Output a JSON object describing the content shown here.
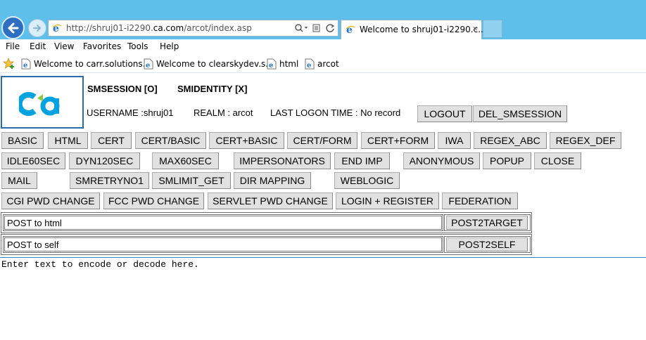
{
  "browser": {
    "address_url_prefix": "http://shruj01-i2290.",
    "address_url_domain": "ca.com",
    "address_url_suffix": "/arcot/index.asp",
    "tab_title": "Welcome to shruj01-i2290.c...",
    "tab_close": "×",
    "address_icons": {
      "search": "search-icon",
      "compat": "compatibility-view-icon",
      "refresh": "refresh-icon"
    },
    "accent_color": "#5ec0ea"
  },
  "menubar": {
    "items": [
      "File",
      "Edit",
      "View",
      "Favorites",
      "Tools",
      "Help"
    ]
  },
  "favorites": {
    "items": [
      "Welcome to carr.solutions....",
      "Welcome to clearskydev.s...",
      "html",
      "arcot"
    ]
  },
  "header": {
    "smsession": "SMSESSION [O]",
    "smidentity": "SMIDENTITY [X]",
    "username": "USERNAME :shruj01",
    "realm": "REALM : arcot",
    "last_logon": "LAST LOGON TIME : No record",
    "logout_label": "LOGOUT",
    "del_smsession_label": "DEL_SMSESSION"
  },
  "buttons": {
    "row1": [
      "BASIC",
      "HTML",
      "CERT",
      "CERT/BASIC",
      "CERT+BASIC",
      "CERT/FORM",
      "CERT+FORM",
      "IWA",
      "REGEX_ABC",
      "REGEX_DEF"
    ],
    "row2": [
      "IDLE60SEC",
      "DYN120SEC",
      "MAX60SEC",
      "IMPERSONATORS",
      "END IMP",
      "ANONYMOUS",
      "POPUP",
      "CLOSE"
    ],
    "row3": [
      "MAIL",
      "SMRETRYNO1",
      "SMLIMIT_GET",
      "DIR MAPPING",
      "WEBLOGIC"
    ],
    "row4": [
      "CGI PWD CHANGE",
      "FCC PWD CHANGE",
      "SERVLET PWD CHANGE",
      "LOGIN + REGISTER",
      "FEDERATION"
    ]
  },
  "post_forms": {
    "html_field_value": "POST to html",
    "html_button": "POST2TARGET",
    "self_field_value": "POST to self",
    "self_button": "POST2SELF"
  },
  "encoder": {
    "text": "Enter text to encode or decode here."
  }
}
